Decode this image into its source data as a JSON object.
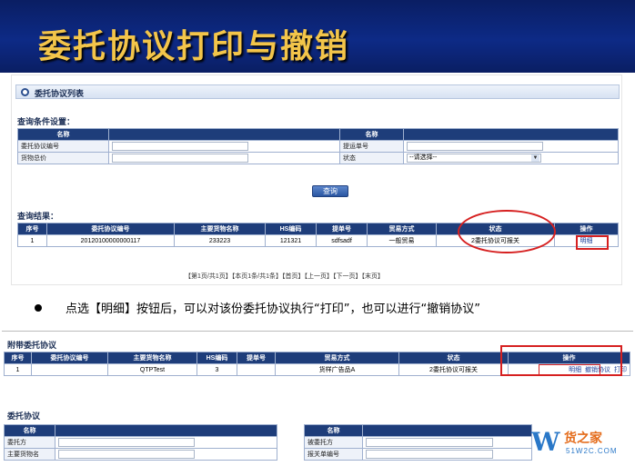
{
  "slide": {
    "title": "委托协议打印与撤销",
    "bullet": "点选【明细】按钮后，可以对该份委托协议执行“打印”，也可以进行“撤销协议”"
  },
  "panel": {
    "title": "委托协议列表"
  },
  "query": {
    "section_title": "查询条件设置：",
    "header_name": "名称",
    "fields": [
      {
        "label": "委托协议编号",
        "value": ""
      },
      {
        "label": "货物总价",
        "value": ""
      },
      {
        "label": "提运单号",
        "value": ""
      },
      {
        "label": "状态",
        "value": "--请选择--"
      }
    ],
    "button": "查询"
  },
  "results": {
    "section_title": "查询结果：",
    "columns": [
      "序号",
      "委托协议编号",
      "主要货物名称",
      "HS编码",
      "提单号",
      "贸易方式",
      "状态",
      "操作"
    ],
    "rows": [
      {
        "index": "1",
        "agreement_no": "20120100000000117",
        "goods": "233223",
        "hs": "121321",
        "bill": "sdfsadf",
        "trade": "一般贸易",
        "status": "2委托协议可报关",
        "action": "明细"
      }
    ],
    "pager": "【第1页/共1页】【本页1条/共1条】【首页】【上一页】【下一页】【末页】"
  },
  "attached": {
    "section_title": "附带委托协议",
    "columns": [
      "序号",
      "委托协议编号",
      "主要货物名称",
      "HS编码",
      "提单号",
      "贸易方式",
      "状态",
      "操作"
    ],
    "rows": [
      {
        "index": "1",
        "agreement_no": "",
        "goods": "QTPTest",
        "hs": "3",
        "bill": "",
        "trade": "货样广告品A",
        "status": "2委托协议可报关",
        "action_detail": "明细",
        "action_cancel": "撤销协议",
        "action_print": "打印"
      }
    ]
  },
  "agreement": {
    "section_title": "委托协议",
    "header_name": "名称",
    "left_fields": [
      "委托方",
      "主要货物名"
    ],
    "right_fields": [
      "被委托方",
      "报关单编号"
    ]
  },
  "logo": {
    "mark": "W",
    "name": "货之家",
    "url": "51W2C.COM"
  },
  "colors": {
    "header_bg": "#0d2a86",
    "title_color": "#f3c54a",
    "table_header": "#1e3d7a",
    "highlight": "#d62020"
  }
}
